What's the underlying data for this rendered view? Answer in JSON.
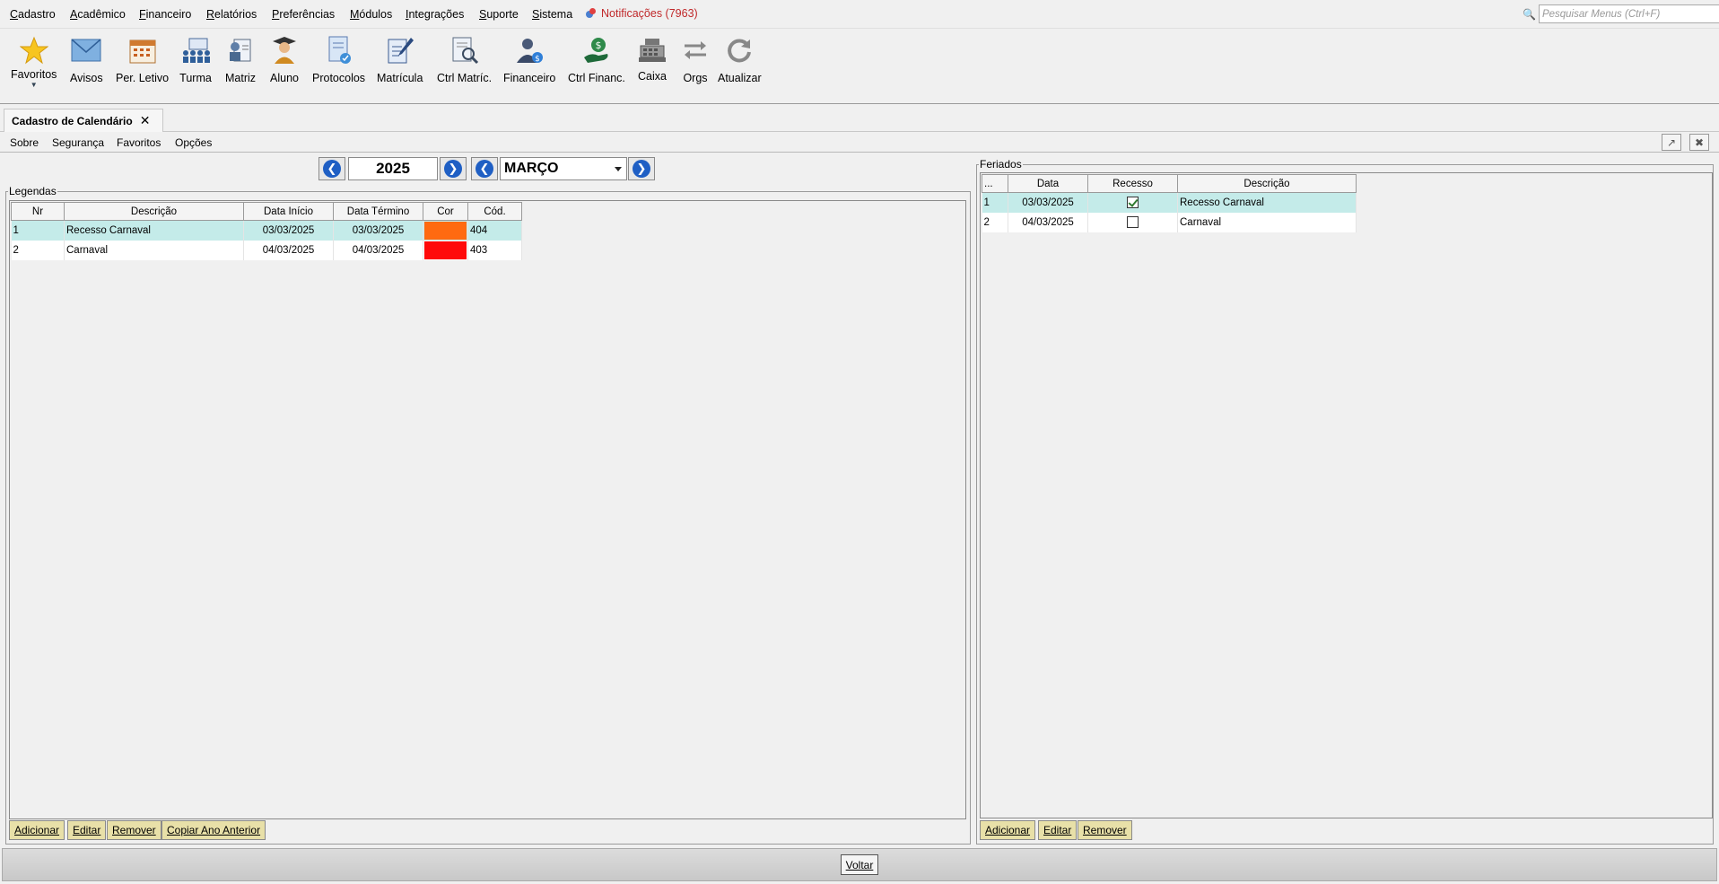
{
  "menu": {
    "items": [
      "Cadastro",
      "Acadêmico",
      "Financeiro",
      "Relatórios",
      "Preferências",
      "Módulos",
      "Integrações",
      "Suporte",
      "Sistema"
    ],
    "notifications": "Notificações (7963)",
    "search_placeholder": "Pesquisar Menus (Ctrl+F)"
  },
  "toolbar": {
    "favoritos": "Favoritos",
    "avisos": "Avisos",
    "per_letivo": "Per. Letivo",
    "turma": "Turma",
    "matriz": "Matriz",
    "aluno": "Aluno",
    "protocolos": "Protocolos",
    "matricula": "Matrícula",
    "ctrl_matric": "Ctrl Matríc.",
    "financeiro": "Financeiro",
    "ctrl_financ": "Ctrl Financ.",
    "caixa": "Caixa",
    "orgs": "Orgs",
    "atualizar": "Atualizar"
  },
  "tab": {
    "title": "Cadastro de Calendário"
  },
  "submenu": [
    "Sobre",
    "Segurança",
    "Favoritos",
    "Opções"
  ],
  "nav": {
    "year": "2025",
    "month": "MARÇO"
  },
  "legendas": {
    "title": "Legendas",
    "headers": [
      "Nr",
      "Descrição",
      "Data Início",
      "Data Término",
      "Cor",
      "Cód."
    ],
    "rows": [
      {
        "nr": "1",
        "descricao": "Recesso Carnaval",
        "inicio": "03/03/2025",
        "termino": "03/03/2025",
        "cor": "#ff6a10",
        "cod": "404"
      },
      {
        "nr": "2",
        "descricao": "Carnaval",
        "inicio": "04/03/2025",
        "termino": "04/03/2025",
        "cor": "#ff0a0a",
        "cod": "403"
      }
    ],
    "buttons": {
      "adicionar": "Adicionar",
      "editar": "Editar",
      "remover": "Remover",
      "copiar": "Copiar Ano Anterior"
    }
  },
  "feriados": {
    "title": "Feriados",
    "headers": [
      "...",
      "Data",
      "Recesso",
      "Descrição"
    ],
    "rows": [
      {
        "nr": "1",
        "data": "03/03/2025",
        "recesso": true,
        "descricao": "Recesso Carnaval"
      },
      {
        "nr": "2",
        "data": "04/03/2025",
        "recesso": false,
        "descricao": "Carnaval"
      }
    ],
    "buttons": {
      "adicionar": "Adicionar",
      "editar": "Editar",
      "remover": "Remover"
    }
  },
  "footer": {
    "voltar": "Voltar"
  },
  "colors": {
    "selected_row": "#c4ebe9",
    "action_button": "#e8e0a8",
    "nav_blue": "#1f5fc4",
    "notification": "#c0282a"
  }
}
